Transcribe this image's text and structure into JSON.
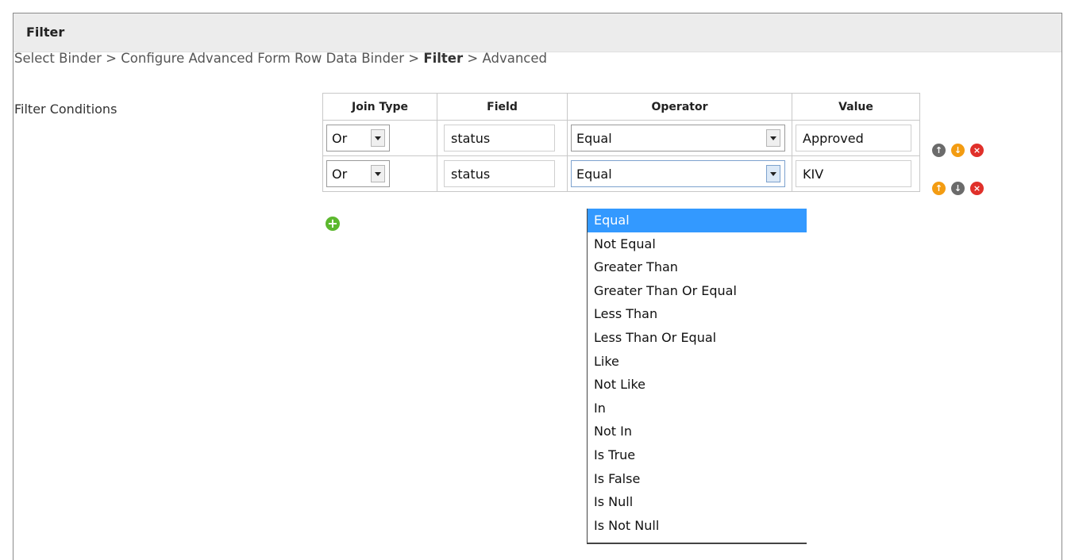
{
  "panel": {
    "title": "Filter"
  },
  "breadcrumb": {
    "step1": "Select Binder",
    "sep": ">",
    "step2": "Configure Advanced Form Row Data Binder",
    "step3": "Filter",
    "step4": "Advanced"
  },
  "filter_conditions_label": "Filter Conditions",
  "table": {
    "headers": [
      "Join Type",
      "Field",
      "Operator",
      "Value"
    ],
    "rows": [
      {
        "join_type": "Or",
        "field": "status",
        "operator": "Equal",
        "value": "Approved"
      },
      {
        "join_type": "Or",
        "field": "status",
        "operator": "Equal",
        "value": "KIV"
      }
    ]
  },
  "operator_options": [
    "Equal",
    "Not Equal",
    "Greater Than",
    "Greater Than Or Equal",
    "Less Than",
    "Less Than Or Equal",
    "Like",
    "Not Like",
    "In",
    "Not In",
    "Is True",
    "Is False",
    "Is Null",
    "Is Not Null"
  ],
  "dropdown_selected": "Equal",
  "icons": {
    "move_up": "arrow-up-icon",
    "move_down": "arrow-down-icon",
    "delete": "delete-icon",
    "add": "add-icon"
  },
  "colors": {
    "header_bg": "#ececec",
    "selected_option": "#3399ff",
    "enabled_action": "#f39c12",
    "disabled_action": "#6b6b6b",
    "delete": "#e0302a",
    "add": "#5cb82e"
  }
}
